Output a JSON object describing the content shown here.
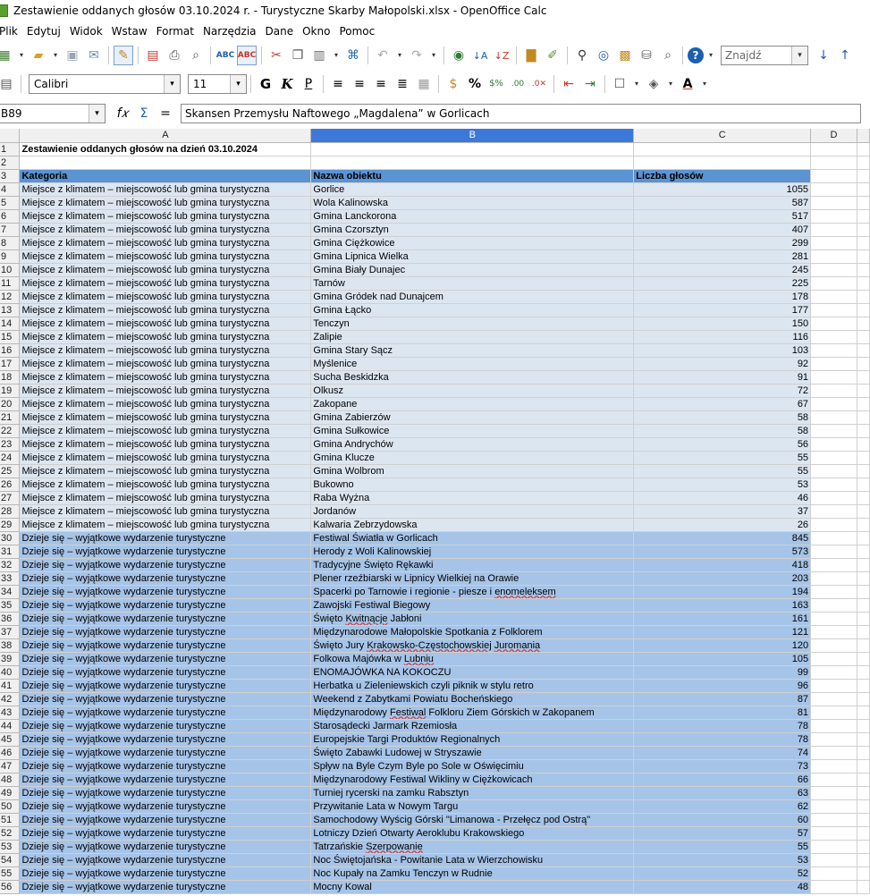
{
  "window": {
    "title": "Zestawienie oddanych głosów 03.10.2024 r. - Turystyczne Skarby Małopolski.xlsx - OpenOffice Calc"
  },
  "menu": [
    "Plik",
    "Edytuj",
    "Widok",
    "Wstaw",
    "Format",
    "Narzędzia",
    "Dane",
    "Okno",
    "Pomoc"
  ],
  "toolbar": {
    "find_placeholder": "Znajdź",
    "font_name": "Calibri",
    "font_size": "11",
    "bold_label": "G",
    "italic_label": "K",
    "underline_label": "P"
  },
  "formula_bar": {
    "cell_ref": "B89",
    "content": "Skansen Przemysłu Naftowego „Magdalena” w Gorlicach"
  },
  "sheet": {
    "columns": [
      "A",
      "B",
      "C",
      "D"
    ],
    "selected_column": "B",
    "title_cell": "Zestawienie oddanych głosów na dzień 03.10.2024",
    "headers": [
      "Kategoria",
      "Nazwa obiektu",
      "Liczba głosów"
    ],
    "rows": [
      {
        "n": 4,
        "a": "Miejsce z klimatem – miejscowość lub gmina turystyczna",
        "b": "Gorlice",
        "c": "1055"
      },
      {
        "n": 5,
        "a": "Miejsce z klimatem – miejscowość lub gmina turystyczna",
        "b": "Wola Kalinowska",
        "c": "587"
      },
      {
        "n": 6,
        "a": "Miejsce z klimatem – miejscowość lub gmina turystyczna",
        "b": "Gmina Lanckorona",
        "c": "517"
      },
      {
        "n": 7,
        "a": "Miejsce z klimatem – miejscowość lub gmina turystyczna",
        "b": "Gmina Czorsztyn",
        "c": "407"
      },
      {
        "n": 8,
        "a": "Miejsce z klimatem – miejscowość lub gmina turystyczna",
        "b": "Gmina Ciężkowice",
        "c": "299"
      },
      {
        "n": 9,
        "a": "Miejsce z klimatem – miejscowość lub gmina turystyczna",
        "b": "Gmina Lipnica Wielka",
        "c": "281"
      },
      {
        "n": 10,
        "a": "Miejsce z klimatem – miejscowość lub gmina turystyczna",
        "b": "Gmina Biały Dunajec",
        "c": "245"
      },
      {
        "n": 11,
        "a": "Miejsce z klimatem – miejscowość lub gmina turystyczna",
        "b": "Tarnów",
        "c": "225"
      },
      {
        "n": 12,
        "a": "Miejsce z klimatem – miejscowość lub gmina turystyczna",
        "b": "Gmina Gródek nad Dunajcem",
        "c": "178"
      },
      {
        "n": 13,
        "a": "Miejsce z klimatem – miejscowość lub gmina turystyczna",
        "b": "Gmina Łącko",
        "c": "177"
      },
      {
        "n": 14,
        "a": "Miejsce z klimatem – miejscowość lub gmina turystyczna",
        "b": "Tenczyn",
        "c": "150"
      },
      {
        "n": 15,
        "a": "Miejsce z klimatem – miejscowość lub gmina turystyczna",
        "b": "Zalipie",
        "c": "116"
      },
      {
        "n": 16,
        "a": "Miejsce z klimatem – miejscowość lub gmina turystyczna",
        "b": "Gmina Stary Sącz",
        "c": "103"
      },
      {
        "n": 17,
        "a": "Miejsce z klimatem – miejscowość lub gmina turystyczna",
        "b": "Myślenice",
        "c": "92"
      },
      {
        "n": 18,
        "a": "Miejsce z klimatem – miejscowość lub gmina turystyczna",
        "b": "Sucha Beskidzka",
        "c": "91"
      },
      {
        "n": 19,
        "a": "Miejsce z klimatem – miejscowość lub gmina turystyczna",
        "b": "Olkusz",
        "c": "72"
      },
      {
        "n": 20,
        "a": "Miejsce z klimatem – miejscowość lub gmina turystyczna",
        "b": "Zakopane",
        "c": "67"
      },
      {
        "n": 21,
        "a": "Miejsce z klimatem – miejscowość lub gmina turystyczna",
        "b": "Gmina Zabierzów",
        "c": "58"
      },
      {
        "n": 22,
        "a": "Miejsce z klimatem – miejscowość lub gmina turystyczna",
        "b": "Gmina Sułkowice",
        "c": "58"
      },
      {
        "n": 23,
        "a": "Miejsce z klimatem – miejscowość lub gmina turystyczna",
        "b": "Gmina Andrychów",
        "c": "56"
      },
      {
        "n": 24,
        "a": "Miejsce z klimatem – miejscowość lub gmina turystyczna",
        "b": "Gmina Klucze",
        "c": "55"
      },
      {
        "n": 25,
        "a": "Miejsce z klimatem – miejscowość lub gmina turystyczna",
        "b": "Gmina Wolbrom",
        "c": "55"
      },
      {
        "n": 26,
        "a": "Miejsce z klimatem – miejscowość lub gmina turystyczna",
        "b": "Bukowno",
        "c": "53"
      },
      {
        "n": 27,
        "a": "Miejsce z klimatem – miejscowość lub gmina turystyczna",
        "b": "Raba Wyżna",
        "c": "46"
      },
      {
        "n": 28,
        "a": "Miejsce z klimatem – miejscowość lub gmina turystyczna",
        "b": "Jordanów",
        "c": "37"
      },
      {
        "n": 29,
        "a": "Miejsce z klimatem – miejscowość lub gmina turystyczna",
        "b": "Kalwaria Zebrzydowska",
        "c": "26"
      },
      {
        "n": 30,
        "a": "Dzieje się – wyjątkowe wydarzenie turystyczne",
        "b": "Festiwal Światła w Gorlicach",
        "c": "845"
      },
      {
        "n": 31,
        "a": "Dzieje się – wyjątkowe wydarzenie turystyczne",
        "b": "Herody z Woli Kalinowskiej",
        "c": "573"
      },
      {
        "n": 32,
        "a": "Dzieje się – wyjątkowe wydarzenie turystyczne",
        "b": "Tradycyjne Święto Rękawki",
        "c": "418"
      },
      {
        "n": 33,
        "a": "Dzieje się – wyjątkowe wydarzenie turystyczne",
        "b": "Plener rzeźbiarski w Lipnicy Wielkiej na Orawie",
        "c": "203"
      },
      {
        "n": 34,
        "a": "Dzieje się – wyjątkowe wydarzenie turystyczne",
        "b": "Spacerki po Tarnowie i regionie - piesze i enomeleksem",
        "c": "194"
      },
      {
        "n": 35,
        "a": "Dzieje się – wyjątkowe wydarzenie turystyczne",
        "b": "Zawojski Festiwal Biegowy",
        "c": "163"
      },
      {
        "n": 36,
        "a": "Dzieje się – wyjątkowe wydarzenie turystyczne",
        "b": "Święto Kwitnącje Jabłoni",
        "c": "161"
      },
      {
        "n": 37,
        "a": "Dzieje się – wyjątkowe wydarzenie turystyczne",
        "b": "Międzynarodowe Małopolskie Spotkania z Folklorem",
        "c": "121"
      },
      {
        "n": 38,
        "a": "Dzieje się – wyjątkowe wydarzenie turystyczne",
        "b": "Święto Jury Krakowsko-Częstochowskiej Juromania",
        "c": "120"
      },
      {
        "n": 39,
        "a": "Dzieje się – wyjątkowe wydarzenie turystyczne",
        "b": "Folkowa Majówka w Lubniu",
        "c": "105"
      },
      {
        "n": 40,
        "a": "Dzieje się – wyjątkowe wydarzenie turystyczne",
        "b": "ENOMAJÓWKA NA KOKOCZU",
        "c": "99"
      },
      {
        "n": 41,
        "a": "Dzieje się – wyjątkowe wydarzenie turystyczne",
        "b": "Herbatka u Zieleniewskich czyli piknik w stylu retro",
        "c": "96"
      },
      {
        "n": 42,
        "a": "Dzieje się – wyjątkowe wydarzenie turystyczne",
        "b": "Weekend z Zabytkami Powiatu Bocheńskiego",
        "c": "87"
      },
      {
        "n": 43,
        "a": "Dzieje się – wyjątkowe wydarzenie turystyczne",
        "b": "Międzynarodowy Festiwal Folkloru Ziem Górskich w Zakopanem",
        "c": "81"
      },
      {
        "n": 44,
        "a": "Dzieje się – wyjątkowe wydarzenie turystyczne",
        "b": "Starosądecki Jarmark Rzemiosła",
        "c": "78"
      },
      {
        "n": 45,
        "a": "Dzieje się – wyjątkowe wydarzenie turystyczne",
        "b": "Europejskie Targi Produktów Regionalnych",
        "c": "78"
      },
      {
        "n": 46,
        "a": "Dzieje się – wyjątkowe wydarzenie turystyczne",
        "b": "Święto Zabawki Ludowej w Stryszawie",
        "c": "74"
      },
      {
        "n": 47,
        "a": "Dzieje się – wyjątkowe wydarzenie turystyczne",
        "b": "Spływ na Byle Czym Byle po Sole w Oświęcimiu",
        "c": "73"
      },
      {
        "n": 48,
        "a": "Dzieje się – wyjątkowe wydarzenie turystyczne",
        "b": "Międzynarodowy Festiwal Wikliny w Ciężkowicach",
        "c": "66"
      },
      {
        "n": 49,
        "a": "Dzieje się – wyjątkowe wydarzenie turystyczne",
        "b": "Turniej rycerski na zamku Rabsztyn",
        "c": "63"
      },
      {
        "n": 50,
        "a": "Dzieje się – wyjątkowe wydarzenie turystyczne",
        "b": "Przywitanie Lata w Nowym Targu",
        "c": "62"
      },
      {
        "n": 51,
        "a": "Dzieje się – wyjątkowe wydarzenie turystyczne",
        "b": "Samochodowy Wyścig Górski \"Limanowa - Przełęcz pod Ostrą\"",
        "c": "60"
      },
      {
        "n": 52,
        "a": "Dzieje się – wyjątkowe wydarzenie turystyczne",
        "b": "Lotniczy Dzień Otwarty Aeroklubu Krakowskiego",
        "c": "57"
      },
      {
        "n": 53,
        "a": "Dzieje się – wyjątkowe wydarzenie turystyczne",
        "b": "Tatrzańskie Szerpowanie",
        "c": "55"
      },
      {
        "n": 54,
        "a": "Dzieje się – wyjątkowe wydarzenie turystyczne",
        "b": "Noc Świętojańska - Powitanie Lata w Wierzchowisku",
        "c": "53"
      },
      {
        "n": 55,
        "a": "Dzieje się – wyjątkowe wydarzenie turystyczne",
        "b": "Noc Kupały na Zamku Tenczyn w Rudnie",
        "c": "52"
      },
      {
        "n": 56,
        "a": "Dzieje się – wyjątkowe wydarzenie turystyczne",
        "b": "Mocny Kowal",
        "c": "48"
      }
    ]
  },
  "colors": {
    "header_fill": "#5b93d3",
    "category1_fill": "#dce6f1",
    "category2_fill": "#a6c4e8",
    "selected_column_header": "#3c78d8"
  }
}
